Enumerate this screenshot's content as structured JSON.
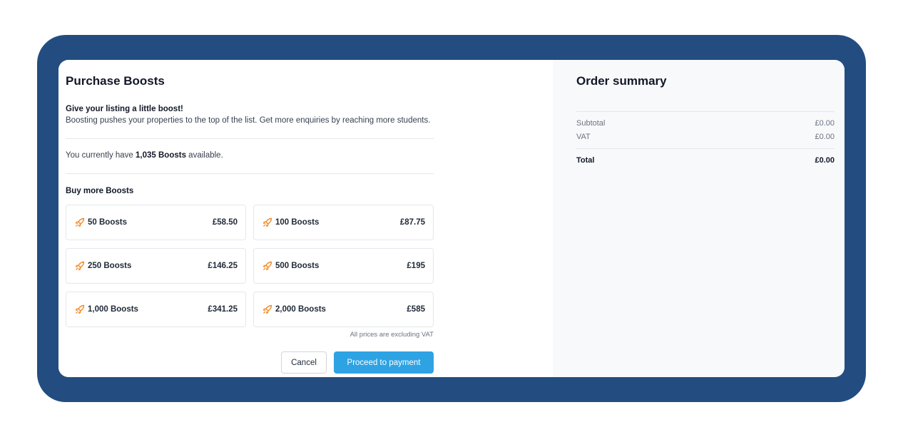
{
  "purchase": {
    "title": "Purchase Boosts",
    "subheading": "Give your listing a little boost!",
    "description": "Boosting pushes your properties to the top of the list. Get more enquiries by reaching more students.",
    "balance_prefix": "You currently have ",
    "balance_value": "1,035 Boosts",
    "balance_suffix": " available.",
    "buy_label": "Buy more Boosts",
    "options": [
      {
        "name": "50 Boosts",
        "price": "£58.50"
      },
      {
        "name": "100 Boosts",
        "price": "£87.75"
      },
      {
        "name": "250 Boosts",
        "price": "£146.25"
      },
      {
        "name": "500 Boosts",
        "price": "£195"
      },
      {
        "name": "1,000 Boosts",
        "price": "£341.25"
      },
      {
        "name": "2,000 Boosts",
        "price": "£585"
      }
    ],
    "vat_note": "All prices are excluding VAT",
    "cancel_label": "Cancel",
    "proceed_label": "Proceed to payment",
    "icon": "rocket-icon",
    "accent_color": "#f08a24",
    "primary_color": "#2ea3e3"
  },
  "summary": {
    "title": "Order summary",
    "subtotal_label": "Subtotal",
    "subtotal_value": "£0.00",
    "vat_label": "VAT",
    "vat_value": "£0.00",
    "total_label": "Total",
    "total_value": "£0.00"
  },
  "frame_color": "#234d80"
}
